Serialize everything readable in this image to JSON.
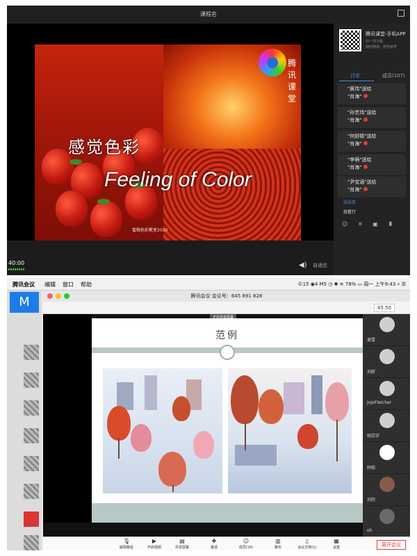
{
  "top": {
    "title": "课程名",
    "slide": {
      "title_cn": "感觉色彩",
      "title_en": "Feeling of Color",
      "brand": "腾讯课堂",
      "footer": "蜜釉色彩教室2020"
    },
    "player": {
      "time": "40:00",
      "fit_label": "自适应"
    },
    "side": {
      "qr_title": "腾讯课堂-手机APP",
      "qr_sub1": "扫一扫下载",
      "qr_sub2": "随时随地，想学就学",
      "tabs": [
        "讨论",
        "成员(107)"
      ],
      "gifts": [
        {
          "line1": "\"黄玮\"送给",
          "line2": "\"肖海\""
        },
        {
          "line1": "\"孙艺玮\"送给",
          "line2": "\"肖海\""
        },
        {
          "line1": "\"何舒婧\"送给",
          "line2": "\"肖海\""
        },
        {
          "line1": "\"李萌\"送给",
          "line2": "\"肖海\""
        },
        {
          "line1": "\"尹宝涵\"送给",
          "line2": "\"肖海\""
        }
      ],
      "chat_name": "张云蕊",
      "chat_msg": "我看行",
      "tools": "☺ ✕ ▣ ♜"
    }
  },
  "meeting": {
    "menu": [
      "腾讯会议",
      "编辑",
      "窗口",
      "帮助"
    ],
    "status_right": "©15 ◉4 M5 ◷ ✱ ≋ 78% ▭ 周一 上午9:43 ⌕ ☰",
    "window_title": "腾讯会议 会议号：645 891 828",
    "timer": "45:50",
    "share_tip": "正在共享屏幕",
    "page_title": "范例",
    "participants": [
      "谢雪",
      "刘昕",
      "JojoFletcher",
      "胡志宇",
      "轩皓",
      "刘欣",
      "eh"
    ],
    "toolbar": [
      {
        "icon": "mic-icon",
        "glyph": "🎙",
        "label": "解除静音"
      },
      {
        "icon": "camera-icon",
        "glyph": "▶",
        "label": "开启视频"
      },
      {
        "icon": "share-screen-icon",
        "glyph": "▤",
        "label": "共享屏幕"
      },
      {
        "icon": "invite-icon",
        "glyph": "✚",
        "label": "邀请"
      },
      {
        "icon": "members-icon",
        "glyph": "☺",
        "label": "成员(18)"
      },
      {
        "icon": "chat-icon",
        "glyph": "▥",
        "label": "聊天"
      },
      {
        "icon": "docs-icon",
        "glyph": "▯",
        "label": "会议文档(1)"
      },
      {
        "icon": "settings-icon",
        "glyph": "▦",
        "label": "设置"
      }
    ],
    "leave_label": "离开会议"
  }
}
